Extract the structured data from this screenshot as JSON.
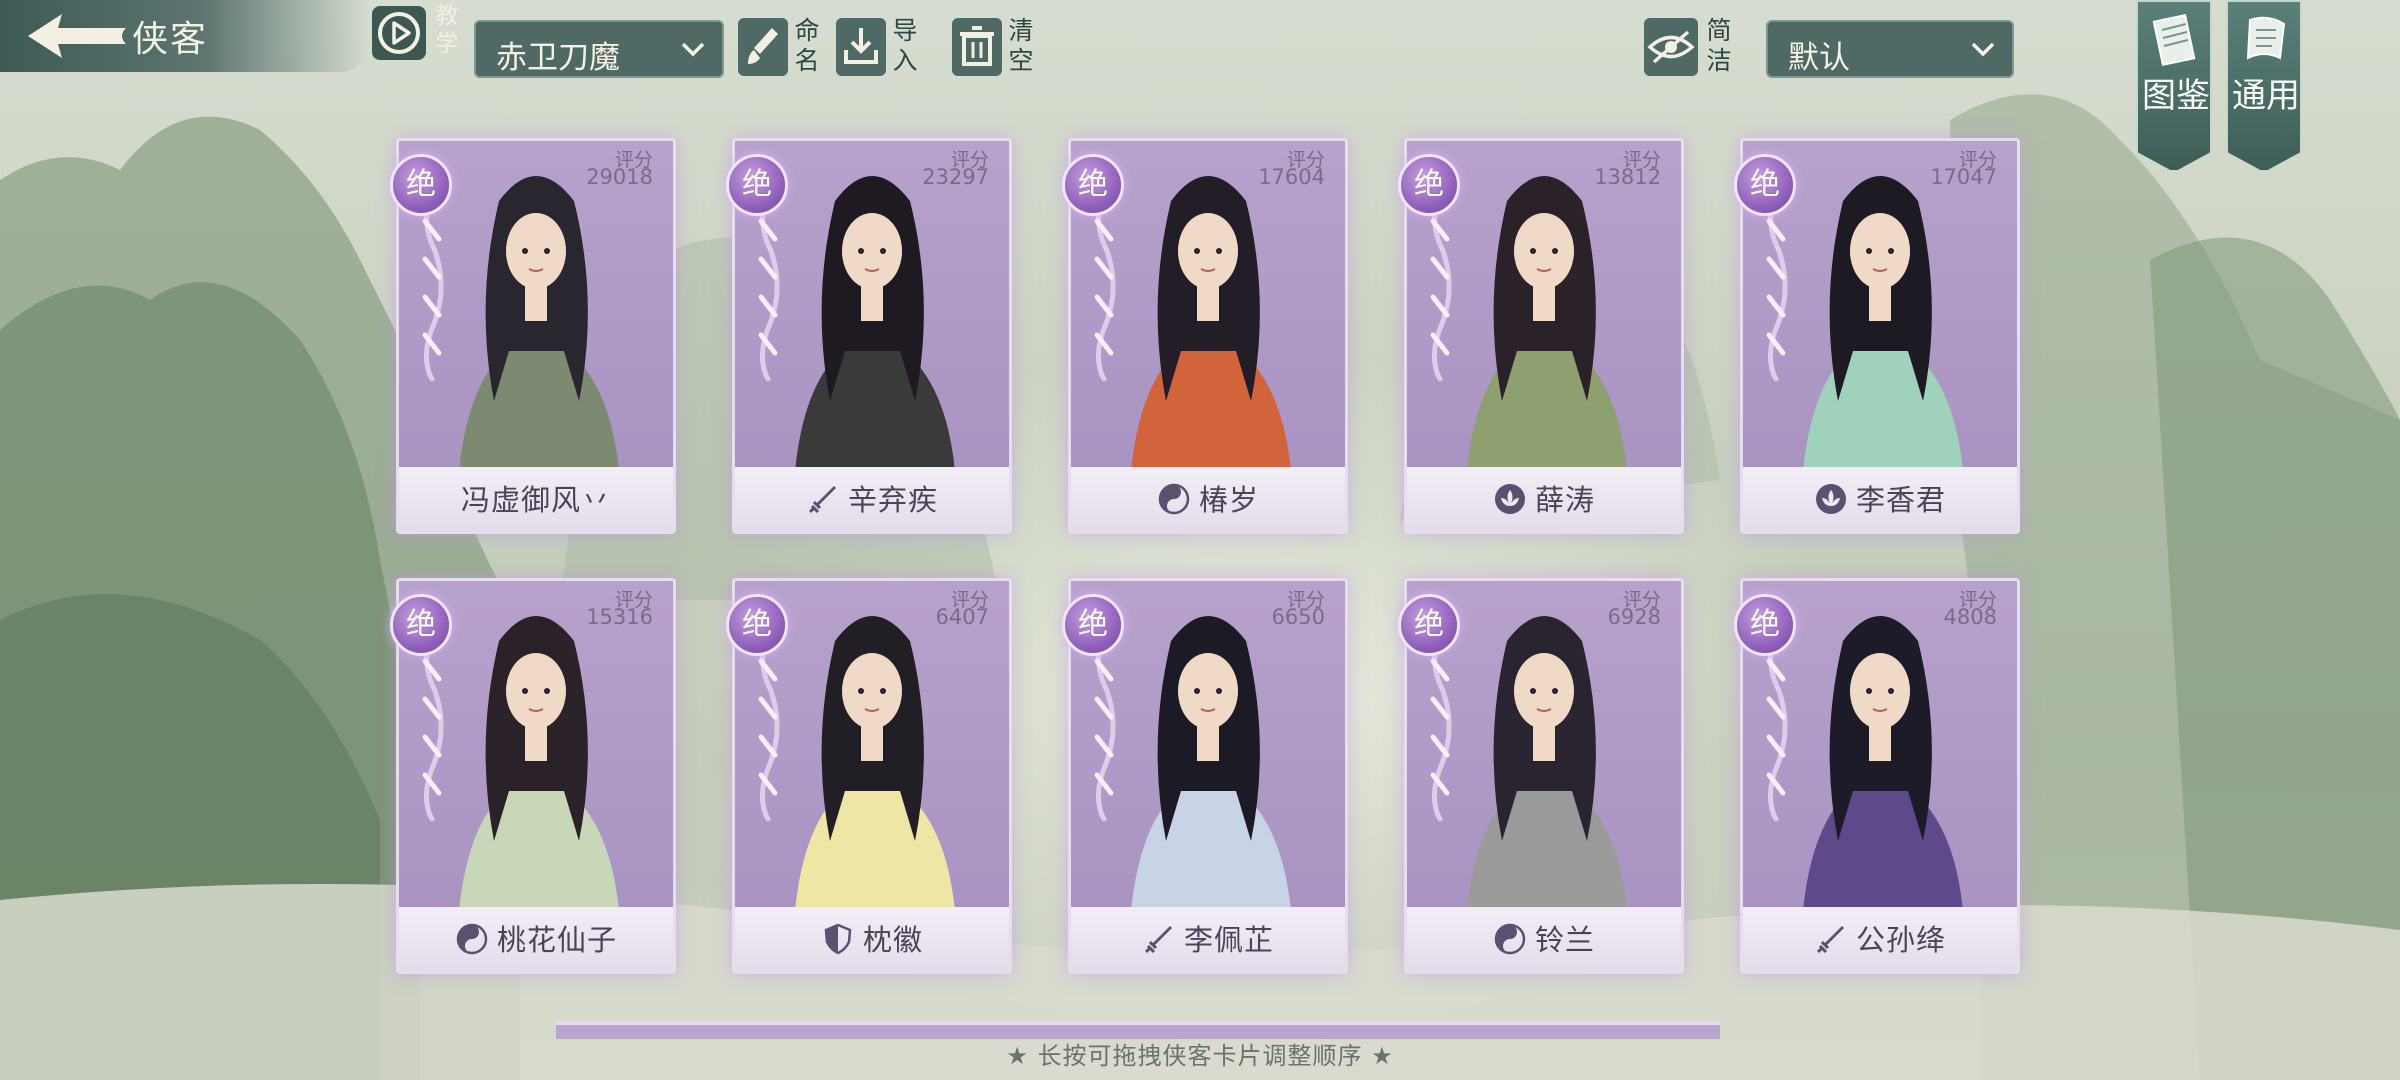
{
  "header": {
    "title": "侠客",
    "teach_label": "教学",
    "team_select": "赤卫刀魔",
    "rename_label": "命名",
    "import_label": "导入",
    "clear_label": "清空",
    "simple_label": "简洁",
    "sort_select": "默认"
  },
  "side": {
    "codex_label": "图鉴",
    "general_label": "通用"
  },
  "score_label": "评分",
  "rank_text": "绝",
  "cards": [
    {
      "name": "冯虚御风丷",
      "score": "29018",
      "faction": "none"
    },
    {
      "name": "辛弃疾",
      "score": "23297",
      "faction": "sword"
    },
    {
      "name": "椿岁",
      "score": "17604",
      "faction": "taiji"
    },
    {
      "name": "薛涛",
      "score": "13812",
      "faction": "lotus"
    },
    {
      "name": "李香君",
      "score": "17047",
      "faction": "lotus"
    },
    {
      "name": "桃花仙子",
      "score": "15316",
      "faction": "taiji"
    },
    {
      "name": "枕徽",
      "score": "6407",
      "faction": "shield"
    },
    {
      "name": "李佩芷",
      "score": "6650",
      "faction": "sword"
    },
    {
      "name": "铃兰",
      "score": "6928",
      "faction": "taiji"
    },
    {
      "name": "公孙绛",
      "score": "4808",
      "faction": "sword"
    }
  ],
  "hint": "★ 长按可拖拽侠客卡片调整顺序 ★",
  "colors": {
    "accent": "#4f6a64",
    "card_purple": "#b9a6cf",
    "badge_purple": "#8a59b4"
  }
}
